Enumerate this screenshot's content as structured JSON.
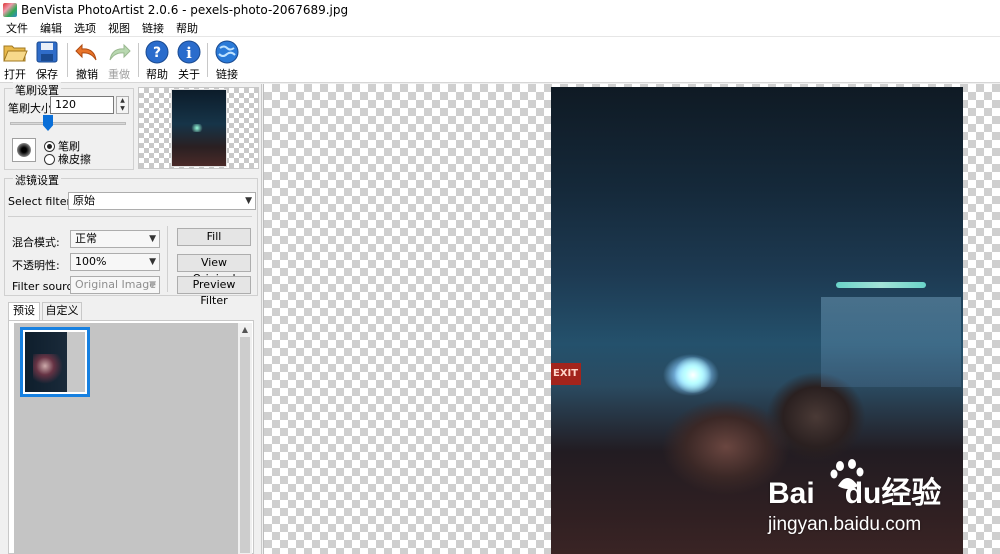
{
  "window": {
    "title": "BenVista PhotoArtist 2.0.6 - pexels-photo-2067689.jpg"
  },
  "menu": [
    "文件",
    "编辑",
    "选项",
    "视图",
    "链接",
    "帮助"
  ],
  "toolbar": {
    "open": "打开",
    "save": "保存",
    "undo": "撤销",
    "redo": "重做",
    "help": "帮助",
    "about": "关于",
    "link": "链接"
  },
  "brush_settings": {
    "title": "笔刷设置",
    "size_label": "笔刷大小:",
    "size_value": "120",
    "slider_value_fraction": 0.31,
    "mode_brush": "笔刷",
    "mode_eraser": "橡皮擦",
    "selected_mode": "笔刷"
  },
  "filter_settings": {
    "title": "滤镜设置",
    "select_filter_label": "Select filter:",
    "select_filter_value": "原始",
    "blend_label": "混合模式:",
    "blend_value": "正常",
    "opacity_label": "不透明性:",
    "opacity_value": "100%",
    "source_label": "Filter source:",
    "source_value": "Original Image",
    "fill_button": "Fill",
    "view_original_button": "View Original",
    "preview_filter_button": "Preview Filter"
  },
  "tabs": {
    "presets": "预设",
    "custom": "自定义",
    "active": "预设"
  },
  "watermark": {
    "brand_left": "Bai",
    "brand_mid": "du",
    "brand_right": "经验",
    "url": "jingyan.baidu.com"
  },
  "photo": {
    "exit_sign": "EXIT"
  },
  "colors": {
    "accent": "#1680e0",
    "slider": "#0a6fd8"
  }
}
